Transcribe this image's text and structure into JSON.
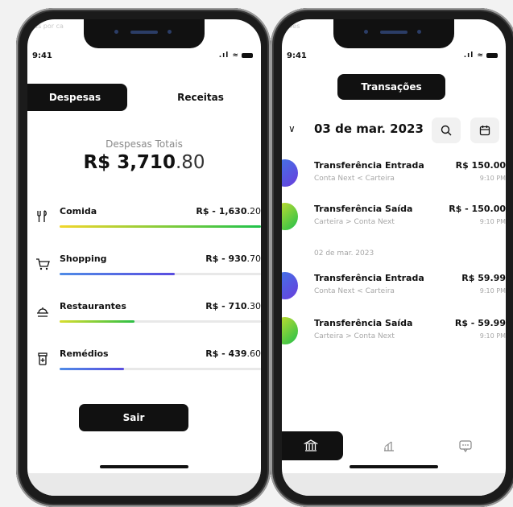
{
  "status": {
    "time": "9:41"
  },
  "left": {
    "ghost_text": "sas por ca",
    "tabs": [
      {
        "label": "Despesas"
      },
      {
        "label": "Receitas"
      }
    ],
    "totals": {
      "label": "Despesas Totais",
      "value_main": "R$ 3,710",
      "value_dec": ".80"
    },
    "categories": [
      {
        "name": "Comida",
        "amount_main": "R$ - 1,630",
        "amount_dec": ".20",
        "icon": "fork-knife-icon",
        "fraction": 1.0,
        "color": "linear-gradient(90deg,#f2d62a,#1fc24b)"
      },
      {
        "name": "Shopping",
        "amount_main": "R$ - 930",
        "amount_dec": ".70",
        "icon": "cart-icon",
        "fraction": 0.57,
        "color": "linear-gradient(90deg,#4f8be6,#5a4de0)"
      },
      {
        "name": "Restaurantes",
        "amount_main": "R$ - 710",
        "amount_dec": ".30",
        "icon": "dish-icon",
        "fraction": 0.37,
        "color": "linear-gradient(90deg,#d8dd2e,#2cbf45)"
      },
      {
        "name": "Remédios",
        "amount_main": "R$ - 439",
        "amount_dec": ".60",
        "icon": "medicine-icon",
        "fraction": 0.32,
        "color": "linear-gradient(90deg,#4f8be6,#5a4de0)"
      }
    ],
    "logout_label": "Sair"
  },
  "right": {
    "ghost_text": "ções",
    "title": "Transações",
    "date": "03 de mar. 2023",
    "separator": "02 de mar. 2023",
    "transactions": [
      {
        "title": "Transferência Entrada",
        "sub": "Conta Next < Carteira",
        "amount": "R$ 150.00",
        "time": "9:10 PM",
        "color": "linear-gradient(135deg,#3d7be8,#6a3ddc)"
      },
      {
        "title": "Transferência Saída",
        "sub": "Carteira > Conta Next",
        "amount": "R$ - 150.00",
        "time": "9:10 PM",
        "color": "linear-gradient(135deg,#d9e02c,#1fbf4b)"
      },
      {
        "title": "Transferência Entrada",
        "sub": "Conta Next < Carteira",
        "amount": "R$ 59.99",
        "time": "9:10 PM",
        "color": "linear-gradient(135deg,#3d7be8,#6a3ddc)"
      },
      {
        "title": "Transferência Saída",
        "sub": "Carteira > Conta Next",
        "amount": "R$ - 59.99",
        "time": "9:10 PM",
        "color": "linear-gradient(135deg,#d9e02c,#1fbf4b)"
      }
    ],
    "nav": [
      "bank-icon",
      "bar-chart-icon",
      "chat-icon"
    ]
  }
}
